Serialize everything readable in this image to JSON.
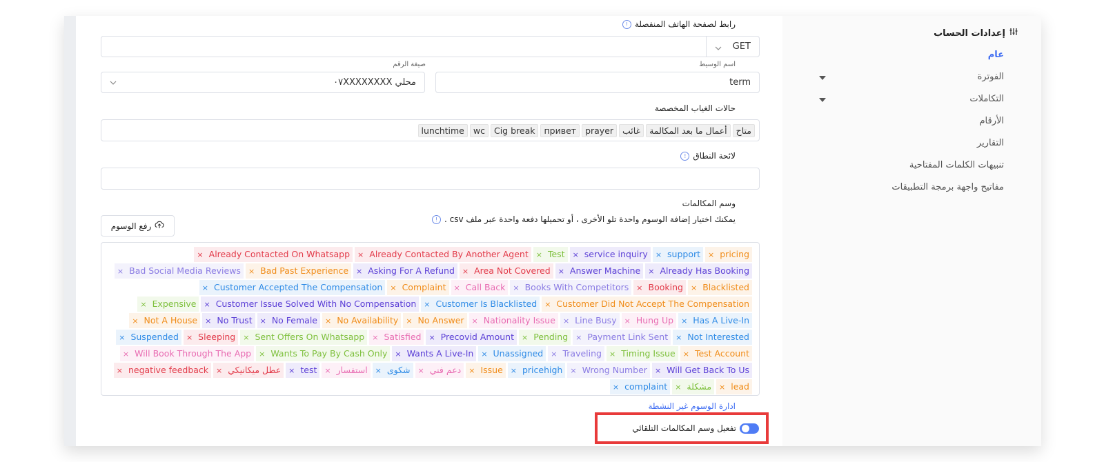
{
  "sidebar": {
    "title": "إعدادات الحساب",
    "items": [
      {
        "label": "عام",
        "active": true,
        "caret": false
      },
      {
        "label": "الفوترة",
        "active": false,
        "caret": true
      },
      {
        "label": "التكاملات",
        "active": false,
        "caret": true
      },
      {
        "label": "الأرقام",
        "active": false,
        "caret": false
      },
      {
        "label": "التقارير",
        "active": false,
        "caret": false
      },
      {
        "label": "تنبيهات الكلمات المفتاحية",
        "active": false,
        "caret": false
      },
      {
        "label": "مفاتيح واجهة برمجة التطبيقات",
        "active": false,
        "caret": false
      }
    ]
  },
  "form": {
    "mobile_link_label": "رابط لصفحة الهاتف المنفصلة",
    "method_value": "GET",
    "url_value": "",
    "param_name_label": "اسم الوسيط",
    "param_name_value": "term",
    "number_format_label": "صيغة الرقم",
    "number_format_value": "محلي ٠٧XXXXXXXX",
    "absence_label": "حالات الغياب المخصصة",
    "absence_chips": [
      "متاح",
      "أعمال ما بعد المكالمة",
      "غائب",
      "prayer",
      "привет",
      "Cig break",
      "wc",
      "lunchtime"
    ],
    "scope_label": "لائحة النطاق",
    "scope_value": "",
    "call_tags_label": "وسم المكالمات",
    "call_tags_help": "يمكنك اختيار إضافة الوسوم واحدة تلو الأخرى ، أو تحميلها دفعة واحدة عبر ملف csv .",
    "upload_button": "رفع الوسوم",
    "manage_link": "ادارة الوسوم غير النشطة",
    "auto_tag_toggle_label": "تفعيل وسم المكالمات التلقائي",
    "auto_tag_enabled": true
  },
  "tag_colors": {
    "orange": "#f08c19",
    "blue": "#2f8be6",
    "purple": "#5b3fd6",
    "green": "#7ec03d",
    "red": "#e23b4a",
    "pink": "#e86cb2",
    "lavender": "#8a7be3"
  },
  "tag_rows": [
    [
      [
        "pricing",
        "orange"
      ],
      [
        "support",
        "blue"
      ],
      [
        "service inquiry",
        "purple"
      ],
      [
        "Test",
        "green"
      ],
      [
        "Already Contacted By Another Agent",
        "red"
      ],
      [
        "Already Contacted On Whatsapp",
        "red"
      ]
    ],
    [
      [
        "Already Has Booking",
        "purple"
      ],
      [
        "Answer Machine",
        "purple"
      ],
      [
        "Area Not Covered",
        "red"
      ],
      [
        "Asking For A Refund",
        "purple"
      ],
      [
        "Bad Past Experience",
        "orange"
      ],
      [
        "Bad Social Media Reviews",
        "lavender"
      ]
    ],
    [
      [
        "Blacklisted",
        "orange"
      ],
      [
        "Booking",
        "red"
      ],
      [
        "Books With Competitors",
        "lavender"
      ],
      [
        "Call Back",
        "pink"
      ],
      [
        "Complaint",
        "orange"
      ],
      [
        "Customer Accepted The Compensation",
        "blue"
      ]
    ],
    [
      [
        "Customer Did Not Accept The Compensation",
        "orange"
      ],
      [
        "Customer Is Blacklisted",
        "blue"
      ],
      [
        "Customer Issue Solved With No Compensation",
        "purple"
      ],
      [
        "Expensive",
        "green"
      ]
    ],
    [
      [
        "Has A Live-In",
        "blue"
      ],
      [
        "Hung Up",
        "pink"
      ],
      [
        "Line Busy",
        "lavender"
      ],
      [
        "Nationality Issue",
        "pink"
      ],
      [
        "No Answer",
        "orange"
      ],
      [
        "No Availability",
        "orange"
      ],
      [
        "No Female",
        "purple"
      ],
      [
        "No Trust",
        "purple"
      ],
      [
        "Not A House",
        "orange"
      ]
    ],
    [
      [
        "Not Interested",
        "blue"
      ],
      [
        "Payment Link Sent",
        "lavender"
      ],
      [
        "Pending",
        "green"
      ],
      [
        "Precovid Amount",
        "purple"
      ],
      [
        "Satisfied",
        "pink"
      ],
      [
        "Sent Offers On Whatsapp",
        "green"
      ],
      [
        "Sleeping",
        "red"
      ],
      [
        "Suspended",
        "blue"
      ]
    ],
    [
      [
        "Test Account",
        "orange"
      ],
      [
        "Timing Issue",
        "green"
      ],
      [
        "Traveling",
        "lavender"
      ],
      [
        "Unassigned",
        "blue"
      ],
      [
        "Wants A Live-In",
        "purple"
      ],
      [
        "Wants To Pay By Cash Only",
        "green"
      ],
      [
        "Will Book Through The App",
        "pink"
      ]
    ],
    [
      [
        "Will Get Back To Us",
        "purple"
      ],
      [
        "Wrong Number",
        "lavender"
      ],
      [
        "pricehigh",
        "blue"
      ],
      [
        "Issue",
        "orange"
      ],
      [
        "دعم فني",
        "pink"
      ],
      [
        "شكوى",
        "blue"
      ],
      [
        "استفسار",
        "pink"
      ],
      [
        "test",
        "purple"
      ],
      [
        "عطل ميكانيكي",
        "red"
      ],
      [
        "negative feedback",
        "red"
      ]
    ],
    [
      [
        "lead",
        "orange"
      ],
      [
        "مشكلة",
        "green"
      ],
      [
        "complaint",
        "blue"
      ]
    ]
  ]
}
